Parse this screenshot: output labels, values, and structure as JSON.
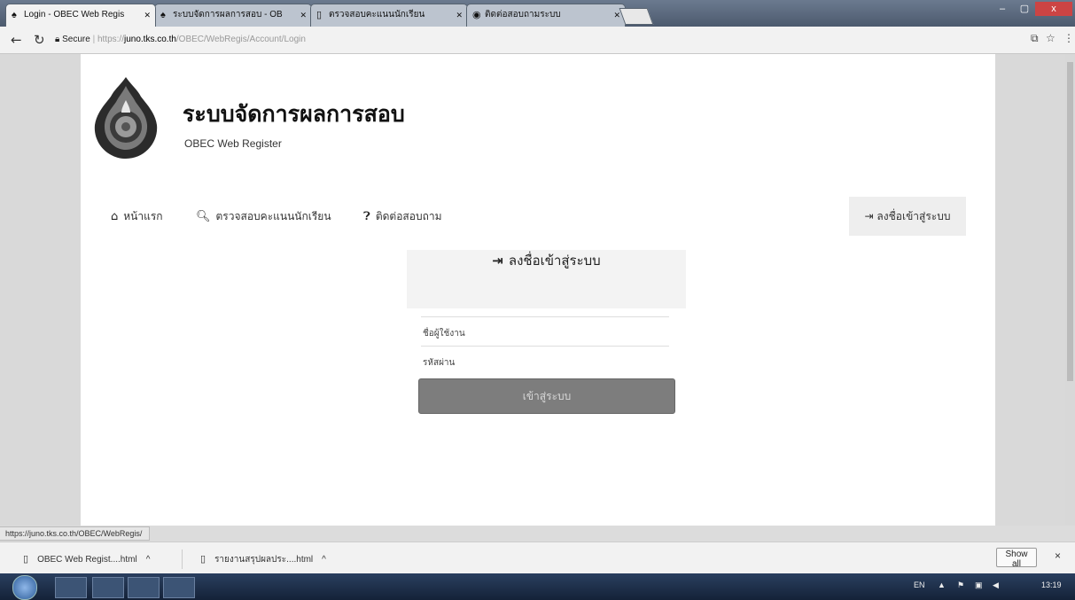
{
  "browser": {
    "tabs": [
      {
        "title": "Login - OBEC Web Regis",
        "active": true
      },
      {
        "title": "ระบบจัดการผลการสอบ - OB",
        "active": false
      },
      {
        "title": "ตรวจสอบคะแนนนักเรียน",
        "active": false
      },
      {
        "title": "ติดต่อสอบถามระบบ",
        "active": false
      }
    ],
    "url": {
      "security_label": "Secure",
      "scheme": "https://",
      "host": "juno.tks.co.th",
      "path": "/OBEC/WebRegis/Account/Login"
    },
    "window_controls": {
      "minimize": "–",
      "maximize": "▢",
      "close": "x"
    }
  },
  "site": {
    "title": "ระบบจัดการผลการสอบ",
    "subtitle": "OBEC Web Register"
  },
  "nav": {
    "items": [
      {
        "icon": "home-icon",
        "label": "หน้าแรก"
      },
      {
        "icon": "search-icon",
        "label": "ตรวจสอบคะแนนนักเรียน"
      },
      {
        "icon": "help-icon",
        "label": "ติดต่อสอบถาม"
      }
    ],
    "login_label": "ลงชื่อเข้าสู่ระบบ"
  },
  "login": {
    "heading": "ลงชื่อเข้าสู่ระบบ",
    "username_placeholder": "ชื่อผู้ใช้งาน",
    "password_placeholder": "รหัสผ่าน",
    "submit_label": "เข้าสู่ระบบ"
  },
  "status_url": "https://juno.tks.co.th/OBEC/WebRegis/",
  "downloads": {
    "items": [
      {
        "name": "OBEC Web Regist....html"
      },
      {
        "name": "รายงานสรุปผลประ....html"
      }
    ],
    "show_all_label": "Show all",
    "close_label": "×"
  },
  "taskbar": {
    "language": "EN",
    "time": "13:19"
  },
  "colors": {
    "submit_bg": "#7d7d7d",
    "nav_login_bg": "#eeeeee",
    "login_box_bg": "#f3f3f3"
  }
}
